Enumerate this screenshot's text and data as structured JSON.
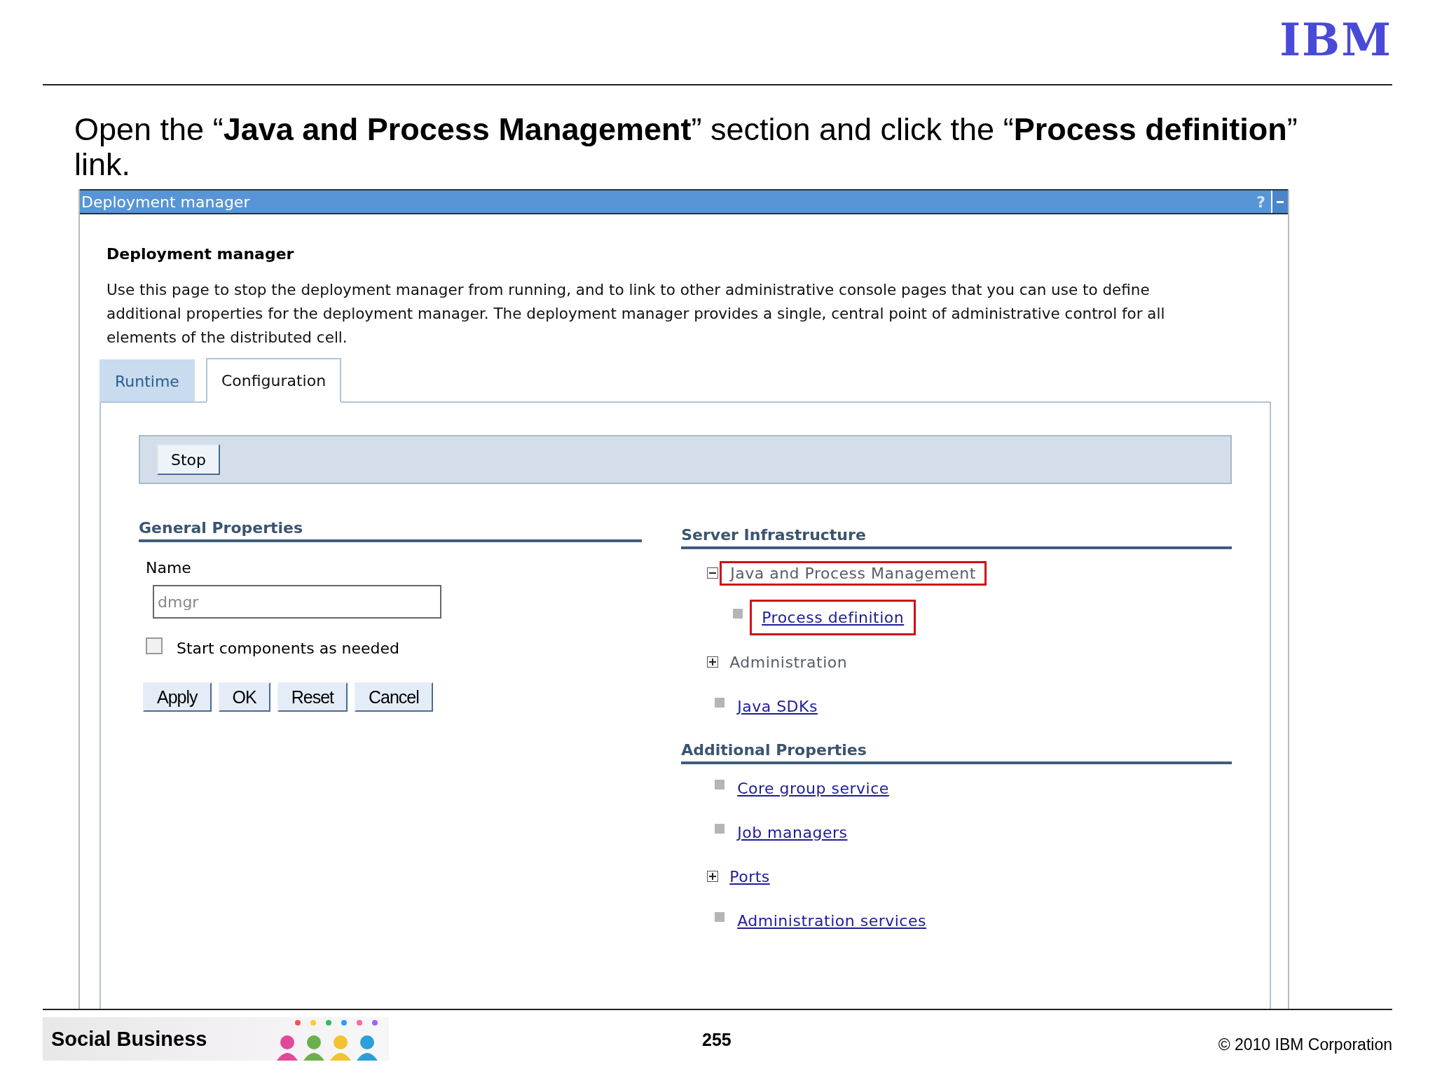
{
  "logo": "IBM",
  "instruction": "Open the “**Java and Process Management**” section and click the “**Process definition**” link.",
  "panel": {
    "title": "Deployment manager",
    "help": "?",
    "heading": "Deployment manager",
    "description": "Use this page to stop the deployment manager from running, and to link to other administrative console pages that you can use to define additional properties for the deployment manager. The deployment manager provides a single, central point of administrative control for all elements of the distributed cell.",
    "tabs": [
      {
        "label": "Runtime",
        "selected": false
      },
      {
        "label": "Configuration",
        "selected": true
      }
    ],
    "actions": [
      "Stop"
    ],
    "general": {
      "title": "General Properties",
      "name_label": "Name",
      "name_value": "dmgr",
      "checkbox": {
        "label": "Start components as needed",
        "checked": false
      },
      "buttons": [
        "Apply",
        "OK",
        "Reset",
        "Cancel"
      ]
    },
    "sections": [
      {
        "title": "Server Infrastructure",
        "items": [
          {
            "label": "Java and Process Management",
            "kind": "group",
            "expanded": true,
            "highlighted": true,
            "children": [
              {
                "label": "Process definition",
                "kind": "link",
                "highlighted": true
              }
            ]
          },
          {
            "label": "Administration",
            "kind": "group",
            "expanded": false,
            "highlighted": false
          },
          {
            "label": "Java SDKs",
            "kind": "link",
            "highlighted": false
          }
        ]
      },
      {
        "title": "Additional Properties",
        "items": [
          {
            "label": "Core group service",
            "kind": "link",
            "highlighted": false
          },
          {
            "label": "Job managers",
            "kind": "link",
            "highlighted": false
          },
          {
            "label": "Ports",
            "kind": "link-group",
            "expanded": false,
            "highlighted": false
          },
          {
            "label": "Administration services",
            "kind": "link",
            "highlighted": false
          }
        ]
      }
    ]
  },
  "footer": {
    "brand": "Social Business",
    "page": "255",
    "copyright": "© 2010 IBM Corporation"
  }
}
